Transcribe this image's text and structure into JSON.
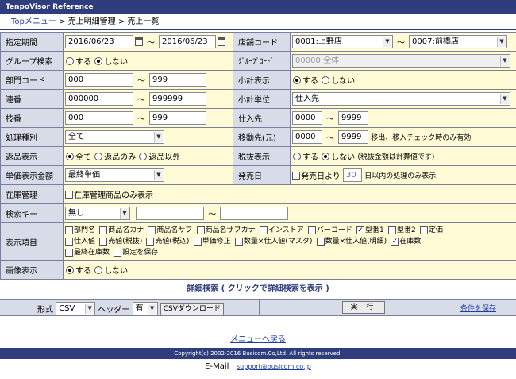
{
  "app": {
    "title": "TenpoVisor Reference"
  },
  "breadcrumb": {
    "top": "Topメニュー",
    "sep": ">",
    "p1": "売上明細管理",
    "p2": "売上一覧"
  },
  "form": {
    "period": {
      "label": "指定期間",
      "from": "2016/06/23",
      "to": "2016/06/23"
    },
    "group": {
      "label": "グループ検索",
      "opt_yes": "する",
      "opt_no": "しない",
      "selected": "しない"
    },
    "dept": {
      "label": "部門コード",
      "from": "000",
      "to": "999"
    },
    "serial": {
      "label": "連番",
      "from": "000000",
      "to": "999999"
    },
    "branch": {
      "label": "枝番",
      "from": "000",
      "to": "999"
    },
    "process": {
      "label": "処理種別",
      "value": "全て"
    },
    "return": {
      "label": "返品表示",
      "opt1": "全て",
      "opt2": "返品のみ",
      "opt3": "返品以外",
      "selected": "全て"
    },
    "unitprice": {
      "label": "単価表示金額",
      "value": "最終単価"
    },
    "stock": {
      "label": "在庫管理",
      "chk": "在庫管理商品のみ表示"
    },
    "searchkey": {
      "label": "検索キー",
      "value": "無し",
      "text1": "",
      "text2": ""
    },
    "display": {
      "label": "表示項目",
      "items": [
        {
          "label": "部門名",
          "checked": false
        },
        {
          "label": "商品名カナ",
          "checked": false
        },
        {
          "label": "商品名サブ",
          "checked": false
        },
        {
          "label": "商品名サブカナ",
          "checked": false
        },
        {
          "label": "インストア",
          "checked": false
        },
        {
          "label": "バーコード",
          "checked": false
        },
        {
          "label": "型番1",
          "checked": true
        },
        {
          "label": "型番2",
          "checked": false
        },
        {
          "label": "定価",
          "checked": false
        },
        {
          "label": "仕入値",
          "checked": false
        },
        {
          "label": "売値(税抜)",
          "checked": false
        },
        {
          "label": "売値(税込)",
          "checked": false
        },
        {
          "label": "単価修正",
          "checked": false
        },
        {
          "label": "数量×仕入値(マスタ)",
          "checked": false
        },
        {
          "label": "数量×仕入値(明細)",
          "checked": false
        },
        {
          "label": "在庫数",
          "checked": true
        },
        {
          "label": "最終在庫数",
          "checked": false
        },
        {
          "label": "設定を保存",
          "checked": false
        }
      ]
    },
    "image": {
      "label": "画像表示",
      "opt_yes": "する",
      "opt_no": "しない",
      "selected": "する"
    },
    "store": {
      "label": "店舗コード",
      "from": "0001:上野店",
      "to": "0007:前橋店"
    },
    "groupcode": {
      "label": "ｸﾞﾙｰﾌﾟｺｰﾄﾞ",
      "value": "00000:全体"
    },
    "subtotal_disp": {
      "label": "小計表示",
      "opt_yes": "する",
      "opt_no": "しない",
      "selected": "する"
    },
    "subtotal_unit": {
      "label": "小計単位",
      "value": "仕入先"
    },
    "supplier": {
      "label": "仕入先",
      "from": "0000",
      "to": "9999"
    },
    "moveto": {
      "label": "移動先(元)",
      "from": "0000",
      "to": "9999",
      "note": "移出、移入チェック時のみ有効"
    },
    "tax": {
      "label": "税抜表示",
      "opt_yes": "する",
      "opt_no": "しない",
      "selected": "しない",
      "note": "(税抜金額は計算値です)"
    },
    "saleday": {
      "label": "発売日",
      "chk": "発売日より",
      "days": "30",
      "note": "日以内の処理のみ表示"
    }
  },
  "detail": {
    "label": "詳細検索 ( クリックで詳細検索を表示 )"
  },
  "bottom": {
    "format_label": "形式",
    "format_value": "CSV",
    "header_label": "ヘッダー",
    "header_value": "有",
    "csv_button": "CSVダウンロード",
    "exec_button": "実 行",
    "save_link": "条件を保存"
  },
  "footer": {
    "back": "メニューへ戻る",
    "copyright": "Copyright(c) 2002-2016 Busicom.Co,Ltd. All rights reserved.",
    "email_label": "E-Mail",
    "email": "support@busicom.co.jp"
  },
  "colors": {
    "header": "#2f3d7d",
    "label_bg": "#d8dce9",
    "value_bg": "#fffbd6"
  }
}
